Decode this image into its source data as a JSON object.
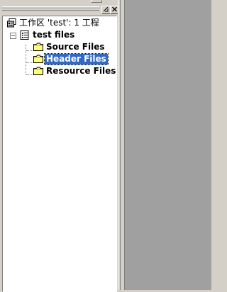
{
  "workspace": {
    "title": "工作区 'test': 1 工程",
    "project": {
      "name": "test files",
      "folders": [
        {
          "label": "Source Files",
          "selected": false
        },
        {
          "label": "Header Files",
          "selected": true
        },
        {
          "label": "Resource Files",
          "selected": false
        }
      ]
    }
  },
  "icons": {
    "workspace": "workspace-icon",
    "project": "project-icon",
    "folder": "folder-icon"
  },
  "colors": {
    "selection": "#316ac5",
    "mdi_background": "#a0a0a0",
    "face": "#d4d0c8"
  }
}
